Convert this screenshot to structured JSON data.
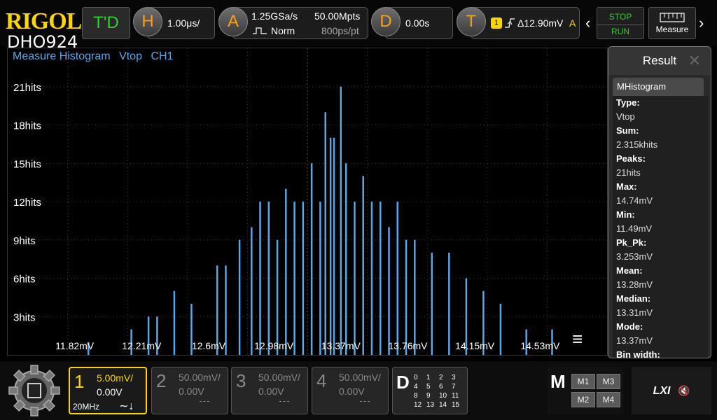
{
  "brand": {
    "logo": "RIGOL",
    "model": "DHO924"
  },
  "topbar": {
    "td_label": "T'D",
    "horizontal": {
      "letter": "H",
      "timebase": "1.00μs/"
    },
    "acquire": {
      "letter": "A",
      "sample_rate": "1.25GSa/s",
      "mode": "Norm",
      "memory_depth": "50.00Mpts",
      "points": "800ps/pt"
    },
    "delay": {
      "letter": "D",
      "value": "0.00s"
    },
    "trigger": {
      "letter": "T",
      "source_badge": "1",
      "level": "Δ12.90mV",
      "sweep": "A"
    },
    "stop_label": "STOP",
    "run_label": "RUN",
    "measure_label": "Measure",
    "prev_arrow": "‹",
    "next_arrow": "›"
  },
  "plot": {
    "title_parts": [
      "Measure Histogram",
      "Vtop",
      "CH1"
    ],
    "menu_glyph": "≡"
  },
  "chart_data": {
    "type": "bar",
    "title": "Measure Histogram  Vtop  CH1",
    "xlabel": "",
    "ylabel": "",
    "x_tick_labels": [
      "11.82mV",
      "12.21mV",
      "12.6mV",
      "12.98mV",
      "13.37mV",
      "13.76mV",
      "14.15mV",
      "14.53mV"
    ],
    "y_tick_labels": [
      "3hits",
      "6hits",
      "9hits",
      "12hits",
      "15hits",
      "18hits",
      "21hits"
    ],
    "xlim": [
      11.43,
      14.92
    ],
    "ylim": [
      0,
      24
    ],
    "grid": true,
    "bar_color": "#5aa7e6",
    "centers": [
      11.9,
      12.15,
      12.25,
      12.3,
      12.4,
      12.5,
      12.65,
      12.7,
      12.78,
      12.85,
      12.9,
      12.95,
      13.0,
      13.05,
      13.1,
      13.15,
      13.2,
      13.25,
      13.28,
      13.31,
      13.33,
      13.37,
      13.4,
      13.45,
      13.5,
      13.55,
      13.6,
      13.65,
      13.7,
      13.75,
      13.8,
      13.9,
      14.0,
      14.1,
      14.2,
      14.3,
      14.45,
      14.6
    ],
    "values": [
      1,
      2,
      3,
      3,
      5,
      4,
      7,
      7,
      9,
      10,
      12,
      12,
      9,
      13,
      12,
      12,
      15,
      12,
      19,
      17,
      17,
      21,
      15,
      12,
      14,
      12,
      12,
      10,
      12,
      9,
      9,
      8,
      8,
      6,
      5,
      4,
      2,
      2
    ]
  },
  "result": {
    "title": "Result",
    "close_glyph": "✕",
    "tab_label": "MHistogram",
    "rows": [
      {
        "label": "Type:",
        "value": "Vtop"
      },
      {
        "label": "Sum:",
        "value": "2.315khits"
      },
      {
        "label": "Peaks:",
        "value": "21hits"
      },
      {
        "label": "Max:",
        "value": "14.74mV"
      },
      {
        "label": "Min:",
        "value": "11.49mV"
      },
      {
        "label": "Pk_Pk:",
        "value": "3.253mV"
      },
      {
        "label": "Mean:",
        "value": "13.28mV"
      },
      {
        "label": "Median:",
        "value": "13.31mV"
      },
      {
        "label": "Mode:",
        "value": "13.37mV"
      },
      {
        "label": "Bin width:",
        "value": ""
      }
    ]
  },
  "channels": [
    {
      "num": "1",
      "scale": "5.00mV/",
      "offset": "0.00V",
      "bandwidth": "20MHz",
      "coupling": "∼↓",
      "color": "#ffd400",
      "active": true
    },
    {
      "num": "2",
      "scale": "50.00mV/",
      "offset": "0.00V",
      "color": "#888888"
    },
    {
      "num": "3",
      "scale": "50.00mV/",
      "offset": "0.00V",
      "color": "#888888"
    },
    {
      "num": "4",
      "scale": "50.00mV/",
      "offset": "0.00V",
      "color": "#888888"
    }
  ],
  "digital": {
    "letter": "D",
    "channels": [
      "0",
      "1",
      "2",
      "3",
      "4",
      "5",
      "6",
      "7",
      "8",
      "9",
      "10",
      "11",
      "12",
      "13",
      "14",
      "15"
    ]
  },
  "math": {
    "letter": "M",
    "buttons": [
      "M1",
      "M3",
      "M2",
      "M4"
    ]
  },
  "status": {
    "lxi": "LXI",
    "mute_icon": "🔇"
  }
}
